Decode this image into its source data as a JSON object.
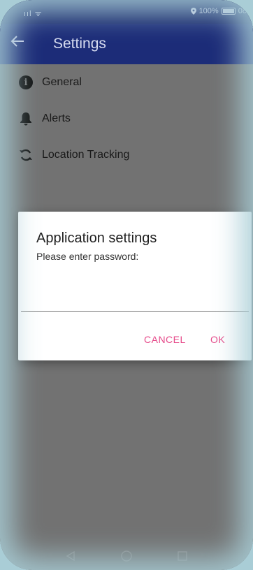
{
  "status_bar": {
    "signal_text": "ııl ᯤ",
    "battery_text": "100%",
    "time_text": "08:"
  },
  "toolbar": {
    "back_icon": "arrow-left-icon",
    "title": "Settings"
  },
  "menu": {
    "items": [
      {
        "label": "General",
        "icon": "info-icon"
      },
      {
        "label": "Alerts",
        "icon": "bell-icon"
      },
      {
        "label": "Location Tracking",
        "icon": "sync-icon"
      }
    ]
  },
  "dialog": {
    "title": "Application settings",
    "message": "Please enter password:",
    "password_value": "",
    "cancel_label": "CANCEL",
    "ok_label": "OK",
    "button_color": "#e64a8a"
  },
  "navbar": {
    "back_icon": "nav-back-icon",
    "home_icon": "nav-home-icon",
    "recents_icon": "nav-recents-icon"
  },
  "colors": {
    "toolbar": "#1c2c78",
    "background_dim": "#727272"
  }
}
